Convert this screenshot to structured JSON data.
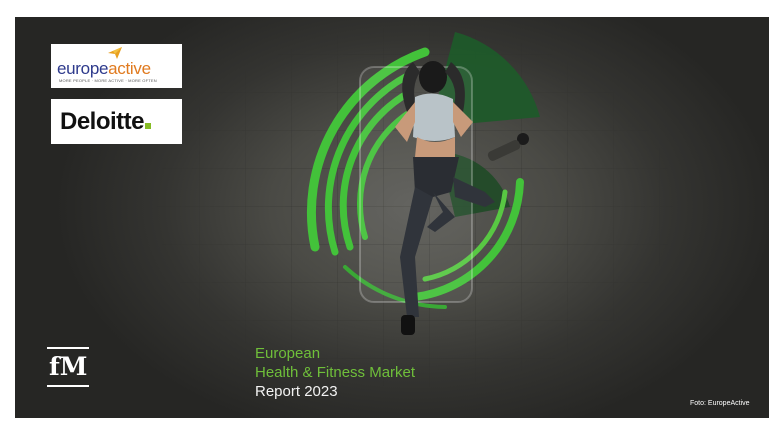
{
  "logos": {
    "europeactive": {
      "word_left": "europe",
      "word_right": "active",
      "tagline": "MORE PEOPLE · MORE ACTIVE · MORE OFTEN"
    },
    "deloitte": {
      "word": "Deloitte"
    },
    "fm": {
      "text": "fM"
    }
  },
  "title": {
    "line1": "European",
    "line2": "Health & Fitness Market",
    "line3": "Report 2023"
  },
  "credit": "Foto: EuropeActive",
  "colors": {
    "accent_green": "#6fbf3a",
    "dark_green": "#1f5a2a",
    "bright_green": "#43c23a"
  }
}
